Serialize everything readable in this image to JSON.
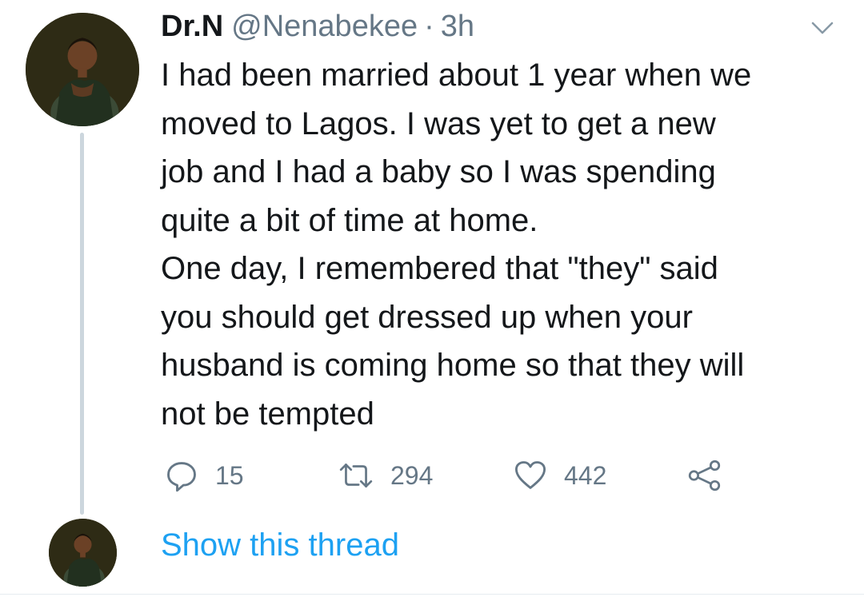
{
  "tweet": {
    "author": {
      "display_name": "Dr.N",
      "handle": "@Nenabekee",
      "separator": "·",
      "time": "3h"
    },
    "text_lines": [
      "I had been married about 1 year when we",
      "moved to Lagos. I was yet to get a new",
      "job and I had a baby so I was spending",
      "quite a bit of time at home.",
      "One day, I remembered that \"they\" said",
      "you should get dressed up when your",
      "husband is coming home so that they will",
      "not be tempted"
    ],
    "actions": {
      "reply_icon": "reply-icon",
      "reply_count": "15",
      "retweet_icon": "retweet-icon",
      "retweet_count": "294",
      "like_icon": "heart-icon",
      "like_count": "442",
      "share_icon": "share-icon"
    }
  },
  "show_thread_label": "Show this thread",
  "colors": {
    "text_primary": "#14171a",
    "text_secondary": "#657786",
    "link": "#1da1f2",
    "thread_line": "#ccd6dd",
    "avatar_background": "#2b2914"
  }
}
